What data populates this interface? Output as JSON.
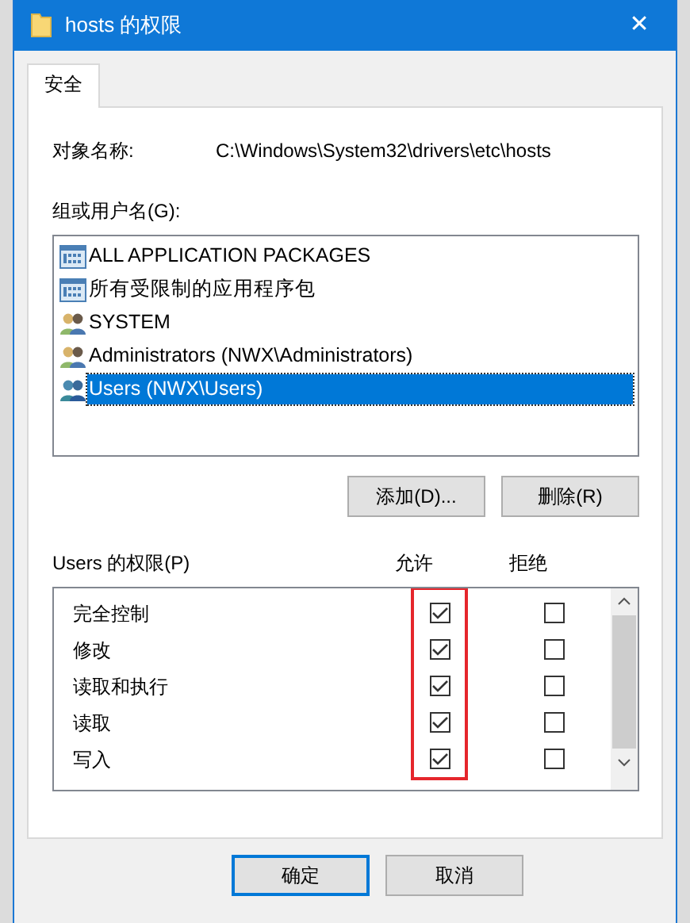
{
  "window": {
    "title": "hosts 的权限",
    "close": "✕"
  },
  "tabs": [
    {
      "label": "安全",
      "selected": true
    }
  ],
  "object": {
    "label": "对象名称:",
    "value": "C:\\Windows\\System32\\drivers\\etc\\hosts"
  },
  "groups": {
    "label": "组或用户名(G):",
    "items": [
      {
        "name": "ALL APPLICATION PACKAGES",
        "kind": "package",
        "selected": false
      },
      {
        "name": "所有受限制的应用程序包",
        "kind": "package",
        "selected": false
      },
      {
        "name": "SYSTEM",
        "kind": "group",
        "selected": false
      },
      {
        "name": "Administrators (NWX\\Administrators)",
        "kind": "group",
        "selected": false
      },
      {
        "name": "Users (NWX\\Users)",
        "kind": "users",
        "selected": true
      }
    ]
  },
  "group_buttons": [
    "添加(D)...",
    "删除(R)"
  ],
  "permissions": {
    "label": "Users 的权限(P)",
    "allow_label": "允许",
    "deny_label": "拒绝",
    "allow_highlighted": true,
    "rows": [
      {
        "name": "完全控制",
        "allow": true,
        "deny": false
      },
      {
        "name": "修改",
        "allow": true,
        "deny": false
      },
      {
        "name": "读取和执行",
        "allow": true,
        "deny": false
      },
      {
        "name": "读取",
        "allow": true,
        "deny": false
      },
      {
        "name": "写入",
        "allow": true,
        "deny": false
      }
    ]
  },
  "buttons": [
    {
      "label": "确定",
      "default": true
    },
    {
      "label": "取消",
      "default": false
    }
  ]
}
